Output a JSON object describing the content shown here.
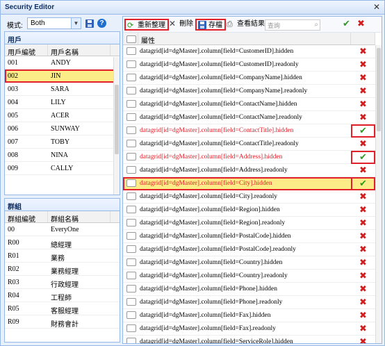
{
  "window": {
    "title": "Security Editor"
  },
  "mode": {
    "label": "模式:",
    "value": "Both"
  },
  "users": {
    "title": "用戶",
    "columns": [
      "用戶編號",
      "用戶名稱"
    ],
    "rows": [
      [
        "001",
        "ANDY"
      ],
      [
        "002",
        "JIN"
      ],
      [
        "003",
        "SARA"
      ],
      [
        "004",
        "LILY"
      ],
      [
        "005",
        "ACER"
      ],
      [
        "006",
        "SUNWAY"
      ],
      [
        "007",
        "TOBY"
      ],
      [
        "008",
        "NINA"
      ],
      [
        "009",
        "CALLY"
      ]
    ],
    "selected_index": 1
  },
  "groups": {
    "title": "群組",
    "columns": [
      "群組編號",
      "群組名稱"
    ],
    "rows": [
      [
        "00",
        "EveryOne"
      ],
      [
        "R00",
        "總經理"
      ],
      [
        "R01",
        "業務"
      ],
      [
        "R02",
        "業務經理"
      ],
      [
        "R03",
        "行政經理"
      ],
      [
        "R04",
        "工程師"
      ],
      [
        "R05",
        "客服經理"
      ],
      [
        "R09",
        "財務會計"
      ]
    ]
  },
  "toolbar": {
    "refresh_label": "重新整理",
    "delete_label": "刪除",
    "save_label": "存檔",
    "view_result_label": "查看結果",
    "search_placeholder": "查詢"
  },
  "props": {
    "column_header": "屬性",
    "rows": [
      {
        "name": "datagrid[id=dgMaster].column[field=CustomerID].hidden",
        "on": false,
        "red": false
      },
      {
        "name": "datagrid[id=dgMaster].column[field=CustomerID].readonly",
        "on": false,
        "red": false
      },
      {
        "name": "datagrid[id=dgMaster].column[field=CompanyName].hidden",
        "on": false,
        "red": false
      },
      {
        "name": "datagrid[id=dgMaster].column[field=CompanyName].readonly",
        "on": false,
        "red": false
      },
      {
        "name": "datagrid[id=dgMaster].column[field=ContactName].hidden",
        "on": false,
        "red": false
      },
      {
        "name": "datagrid[id=dgMaster].column[field=ContactName].readonly",
        "on": false,
        "red": false
      },
      {
        "name": "datagrid[id=dgMaster].column[field=ContactTitle].hidden",
        "on": true,
        "red": true
      },
      {
        "name": "datagrid[id=dgMaster].column[field=ContactTitle].readonly",
        "on": false,
        "red": false
      },
      {
        "name": "datagrid[id=dgMaster].column[field=Address].hidden",
        "on": true,
        "red": true
      },
      {
        "name": "datagrid[id=dgMaster].column[field=Address].readonly",
        "on": false,
        "red": false
      },
      {
        "name": "datagrid[id=dgMaster].column[field=City].hidden",
        "on": true,
        "red": true
      },
      {
        "name": "datagrid[id=dgMaster].column[field=City].readonly",
        "on": false,
        "red": false
      },
      {
        "name": "datagrid[id=dgMaster].column[field=Region].hidden",
        "on": false,
        "red": false
      },
      {
        "name": "datagrid[id=dgMaster].column[field=Region].readonly",
        "on": false,
        "red": false
      },
      {
        "name": "datagrid[id=dgMaster].column[field=PostalCode].hidden",
        "on": false,
        "red": false
      },
      {
        "name": "datagrid[id=dgMaster].column[field=PostalCode].readonly",
        "on": false,
        "red": false
      },
      {
        "name": "datagrid[id=dgMaster].column[field=Country].hidden",
        "on": false,
        "red": false
      },
      {
        "name": "datagrid[id=dgMaster].column[field=Country].readonly",
        "on": false,
        "red": false
      },
      {
        "name": "datagrid[id=dgMaster].column[field=Phone].hidden",
        "on": false,
        "red": false
      },
      {
        "name": "datagrid[id=dgMaster].column[field=Phone].readonly",
        "on": false,
        "red": false
      },
      {
        "name": "datagrid[id=dgMaster].column[field=Fax].hidden",
        "on": false,
        "red": false
      },
      {
        "name": "datagrid[id=dgMaster].column[field=Fax].readonly",
        "on": false,
        "red": false
      },
      {
        "name": "datagrid[id=dgMaster].column[field=ServiceRole].hidden",
        "on": false,
        "red": false
      }
    ],
    "highlighted_index": 10,
    "boxed_indices": [
      6,
      8,
      10
    ]
  },
  "colors": {
    "accent": "#95b8e7",
    "highlight": "#fbec88",
    "annotation": "#e2202a",
    "check": "#2b9b22",
    "cross": "#d21e1e"
  }
}
